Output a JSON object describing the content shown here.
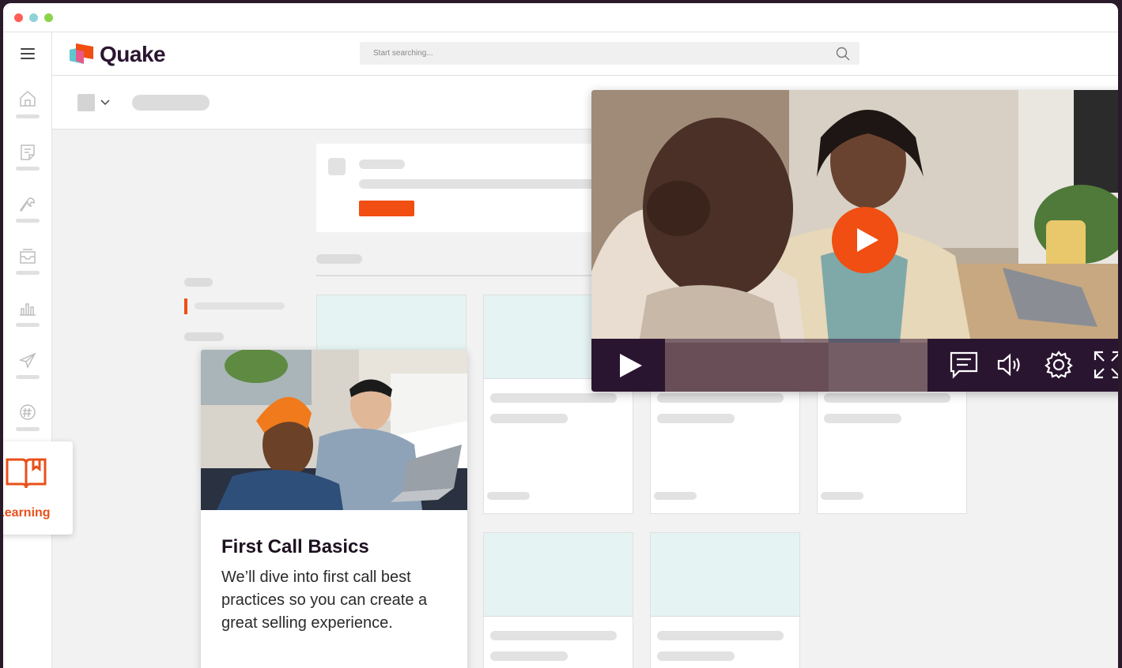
{
  "brand": {
    "name": "Quake",
    "accent": "#e8501a",
    "dark": "#2a1530"
  },
  "window": {
    "dots": [
      "#ff5f57",
      "#8fd3d8",
      "#8cd34a"
    ]
  },
  "header": {
    "search_placeholder": "Start searching..."
  },
  "sidebar": {
    "items": [
      {
        "icon": "home-icon"
      },
      {
        "icon": "notes-icon"
      },
      {
        "icon": "wrench-icon"
      },
      {
        "icon": "inbox-icon"
      },
      {
        "icon": "bar-chart-icon"
      },
      {
        "icon": "send-icon"
      },
      {
        "icon": "hashtag-icon"
      }
    ],
    "learning": {
      "label": "Learning",
      "icon": "book-icon"
    }
  },
  "learning_card": {
    "title": "First Call Basics",
    "description": "We’ll dive into first call best practices so you can create a great selling experience."
  },
  "video_player": {
    "controls": [
      "play-icon",
      "captions-icon",
      "volume-icon",
      "settings-icon",
      "fullscreen-icon"
    ]
  }
}
